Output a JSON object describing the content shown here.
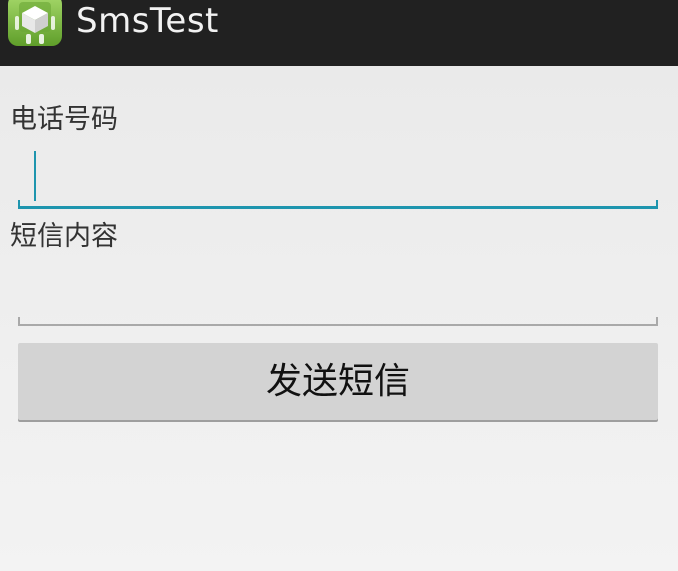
{
  "actionbar": {
    "title": "SmsTest",
    "icon": "android-app-icon"
  },
  "form": {
    "phone_label": "电话号码",
    "phone_value": "",
    "content_label": "短信内容",
    "content_value": "",
    "send_label": "发送短信"
  },
  "colors": {
    "actionbar_bg": "#212121",
    "accent": "#1e95ae",
    "button_bg": "#d3d3d3",
    "icon_green": "#8cc63f"
  }
}
